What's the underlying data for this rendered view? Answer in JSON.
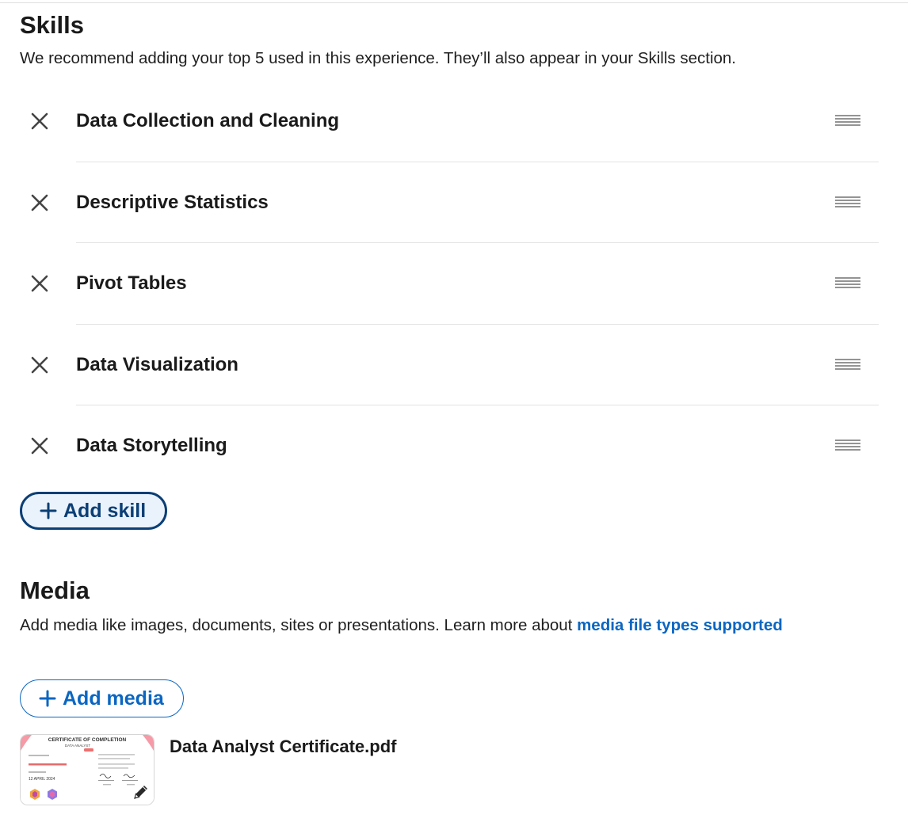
{
  "skills_section": {
    "title": "Skills",
    "description": "We recommend adding your top 5 used in this experience. They’ll also appear in your Skills section.",
    "items": [
      {
        "label": "Data Collection and Cleaning"
      },
      {
        "label": "Descriptive Statistics"
      },
      {
        "label": "Pivot Tables"
      },
      {
        "label": "Data Visualization"
      },
      {
        "label": "Data Storytelling"
      }
    ],
    "add_button_label": "Add skill",
    "icons": {
      "remove": "close-icon",
      "reorder": "drag-handle-icon",
      "add": "plus-icon"
    }
  },
  "media_section": {
    "title": "Media",
    "description": "Add media like images, documents, sites or presentations. Learn more about ",
    "link_text": "media file types supported",
    "add_button_label": "Add media",
    "items": [
      {
        "file_name": "Data Analyst Certificate.pdf",
        "thumbnail": {
          "heading": "CERTIFICATE OF COMPLETION",
          "subheading": "DATA ANALYST",
          "date": "12 APRIL 2024"
        },
        "edit_icon": "pencil-icon"
      }
    ]
  },
  "colors": {
    "link": "#0a66c2",
    "add_skill_border": "#0b3f75",
    "add_skill_bg": "#eaf2fc",
    "text": "#1a1a1a",
    "divider": "#e3e3e3"
  }
}
